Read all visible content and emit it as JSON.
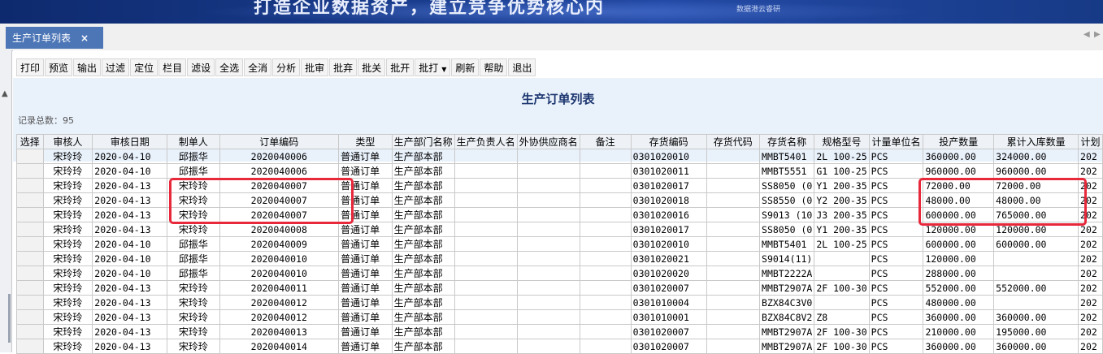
{
  "banner": {
    "headline": "打造企业数据资产，建立竞争优势核心内",
    "sub": "数据港云睿研"
  },
  "tab": {
    "label": "生产订单列表",
    "close": "×"
  },
  "tabnav": {
    "prev": "◀",
    "next": "▶"
  },
  "toolbar": [
    "打印",
    "预览",
    "输出",
    "过滤",
    "定位",
    "栏目",
    "滤设",
    "全选",
    "全消",
    "分析",
    "批审",
    "批弃",
    "批关",
    "批开",
    "批打",
    "刷新",
    "帮助",
    "退出"
  ],
  "toolbar_dropdown_after": "批打",
  "page_title": "生产订单列表",
  "record_count": "记录总数：95",
  "columns": [
    "选择",
    "审核人",
    "审核日期",
    "制单人",
    "订单编码",
    "类型",
    "生产部门名称",
    "生产负责人名",
    "外协供应商名",
    "备注",
    "存货编码",
    "存货代码",
    "存货名称",
    "规格型号",
    "计量单位名",
    "投产数量",
    "累计入库数量",
    "计划"
  ],
  "rows": [
    [
      "",
      "宋玲玲",
      "2020-04-10",
      "邱振华",
      "2020040006",
      "普通订单",
      "生产部本部",
      "",
      "",
      "",
      "0301020010",
      "",
      "MMBT5401",
      "2L 100-25",
      "PCS",
      "360000.00",
      "324000.00",
      "202"
    ],
    [
      "",
      "宋玲玲",
      "2020-04-10",
      "邱振华",
      "2020040006",
      "普通订单",
      "生产部本部",
      "",
      "",
      "",
      "0301020011",
      "",
      "MMBT5551",
      "G1 100-25",
      "PCS",
      "960000.00",
      "960000.00",
      "202"
    ],
    [
      "",
      "宋玲玲",
      "2020-04-13",
      "宋玲玲",
      "2020040007",
      "普通订单",
      "生产部本部",
      "",
      "",
      "",
      "0301020017",
      "",
      "SS8050 (0",
      "Y1 200-35",
      "PCS",
      "72000.00",
      "72000.00",
      "202"
    ],
    [
      "",
      "宋玲玲",
      "2020-04-13",
      "宋玲玲",
      "2020040007",
      "普通订单",
      "生产部本部",
      "",
      "",
      "",
      "0301020018",
      "",
      "SS8550 (0",
      "Y2 200-35",
      "PCS",
      "48000.00",
      "48000.00",
      "202"
    ],
    [
      "",
      "宋玲玲",
      "2020-04-13",
      "宋玲玲",
      "2020040007",
      "普通订单",
      "生产部本部",
      "",
      "",
      "",
      "0301020016",
      "",
      "S9013 (10",
      "J3 200-35",
      "PCS",
      "600000.00",
      "765000.00",
      "202"
    ],
    [
      "",
      "宋玲玲",
      "2020-04-13",
      "宋玲玲",
      "2020040008",
      "普通订单",
      "生产部本部",
      "",
      "",
      "",
      "0301020017",
      "",
      "SS8050 (0",
      "Y1 200-35",
      "PCS",
      "120000.00",
      "120000.00",
      "202"
    ],
    [
      "",
      "宋玲玲",
      "2020-04-10",
      "邱振华",
      "2020040009",
      "普通订单",
      "生产部本部",
      "",
      "",
      "",
      "0301020010",
      "",
      "MMBT5401",
      "2L 100-25",
      "PCS",
      "600000.00",
      "600000.00",
      "202"
    ],
    [
      "",
      "宋玲玲",
      "2020-04-10",
      "邱振华",
      "2020040010",
      "普通订单",
      "生产部本部",
      "",
      "",
      "",
      "0301020021",
      "",
      "S9014(11)",
      "",
      "PCS",
      "120000.00",
      "",
      "202"
    ],
    [
      "",
      "宋玲玲",
      "2020-04-10",
      "邱振华",
      "2020040010",
      "普通订单",
      "生产部本部",
      "",
      "",
      "",
      "0301020020",
      "",
      "MMBT2222A",
      "",
      "PCS",
      "288000.00",
      "",
      "202"
    ],
    [
      "",
      "宋玲玲",
      "2020-04-13",
      "宋玲玲",
      "2020040011",
      "普通订单",
      "生产部本部",
      "",
      "",
      "",
      "0301020007",
      "",
      "MMBT2907A",
      "2F 100-30",
      "PCS",
      "552000.00",
      "552000.00",
      "202"
    ],
    [
      "",
      "宋玲玲",
      "2020-04-13",
      "宋玲玲",
      "2020040012",
      "普通订单",
      "生产部本部",
      "",
      "",
      "",
      "0301010004",
      "",
      "BZX84C3V0",
      "",
      "PCS",
      "480000.00",
      "",
      "202"
    ],
    [
      "",
      "宋玲玲",
      "2020-04-13",
      "宋玲玲",
      "2020040012",
      "普通订单",
      "生产部本部",
      "",
      "",
      "",
      "0301010001",
      "",
      "BZX84C8V2",
      "Z8",
      "PCS",
      "360000.00",
      "360000.00",
      "202"
    ],
    [
      "",
      "宋玲玲",
      "2020-04-13",
      "宋玲玲",
      "2020040013",
      "普通订单",
      "生产部本部",
      "",
      "",
      "",
      "0301020007",
      "",
      "MMBT2907A",
      "2F 100-30",
      "PCS",
      "210000.00",
      "195000.00",
      "202"
    ],
    [
      "",
      "宋玲玲",
      "2020-04-13",
      "宋玲玲",
      "2020040014",
      "普通订单",
      "生产部本部",
      "",
      "",
      "",
      "0301020007",
      "",
      "MMBT2907A",
      "2F 100-30",
      "PCS",
      "360000.00",
      "360000.00",
      "202"
    ]
  ],
  "highlight_color": "#e8283b",
  "tab_color": "#4d76b7",
  "title_bg": "#e9f1fb"
}
